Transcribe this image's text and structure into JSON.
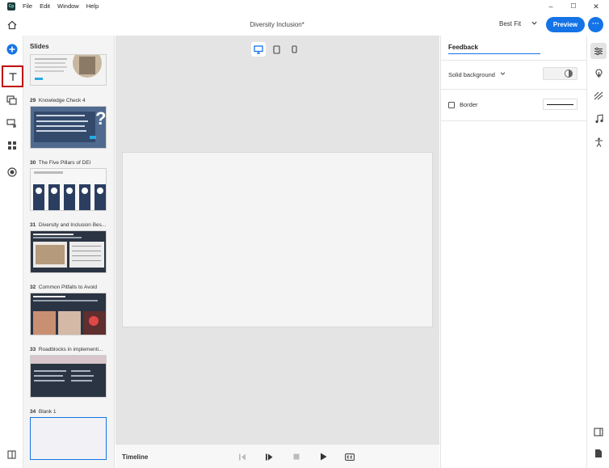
{
  "app": {
    "logo_text": "Cp"
  },
  "menu": [
    "File",
    "Edit",
    "Window",
    "Help"
  ],
  "window_controls": {
    "minimize": "–",
    "maximize": "☐",
    "close": "✕"
  },
  "toolbar": {
    "doc_title": "Diversity Inclusion*",
    "fit_label": "Best Fit",
    "preview_label": "Preview",
    "more_label": "···"
  },
  "left_rail": {
    "items": [
      {
        "name": "home-icon",
        "glyph": "⌂"
      },
      {
        "name": "add-icon",
        "glyph": "+"
      },
      {
        "name": "text-icon",
        "glyph": "T"
      },
      {
        "name": "media-icon",
        "glyph": "▣"
      },
      {
        "name": "interactions-icon",
        "glyph": "⧉"
      },
      {
        "name": "widgets-icon",
        "glyph": "▦"
      },
      {
        "name": "record-icon",
        "glyph": "◉"
      }
    ],
    "bottom_icon": "⧠"
  },
  "slides_panel": {
    "title": "Slides",
    "slides": [
      {
        "number": "",
        "title": ""
      },
      {
        "number": "29",
        "title": "Knowledge Check 4"
      },
      {
        "number": "30",
        "title": "The Five Pillars of DEI"
      },
      {
        "number": "31",
        "title": "Diversity and Inclusion Bes..."
      },
      {
        "number": "32",
        "title": "Common Pitfalls to Avoid"
      },
      {
        "number": "33",
        "title": "Roadblocks in implementi..."
      },
      {
        "number": "34",
        "title": "Blank 1"
      }
    ]
  },
  "timeline": {
    "label": "Timeline"
  },
  "properties": {
    "name_value": "Feedback",
    "background_label": "Solid background",
    "border_label": "Border"
  },
  "colors": {
    "accent": "#1473e6",
    "selection_outline": "#c00000",
    "slide_dark": "#2b3443"
  }
}
